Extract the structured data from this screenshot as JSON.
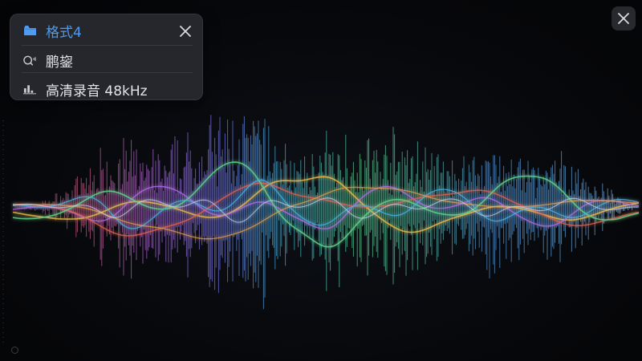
{
  "info_panel": {
    "title": "格式4",
    "title_icon": "folder-icon",
    "row_2_text": "鹏鋆",
    "row_2_icon": "voice-search-icon",
    "row_3_text": "高清录音 48kHz",
    "row_3_icon": "audio-level-icon",
    "close_icon": "close-icon"
  },
  "viewer": {
    "close_icon": "close-icon"
  },
  "colors": {
    "accent": "#4f9bf0",
    "panel_bg": "#2a2c31",
    "text": "#e3e4e8",
    "background": "#07080b",
    "wave_gradient": [
      "#4a6aa8",
      "#c0567a",
      "#9b6be0",
      "#42a6c9",
      "#5fd18a",
      "#e5a13c",
      "#e2604e",
      "#4a8ac8"
    ]
  }
}
